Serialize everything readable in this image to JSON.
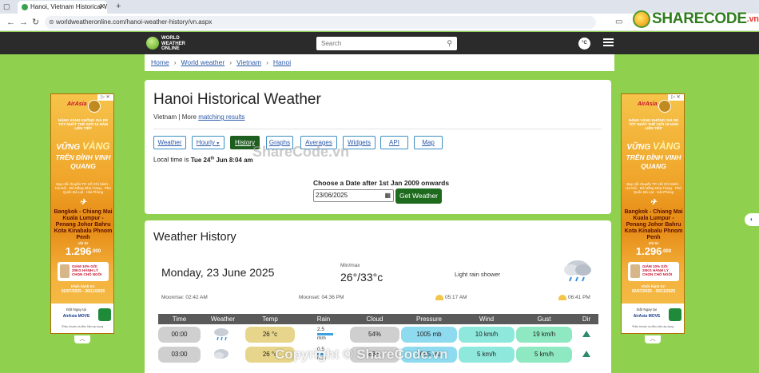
{
  "browser": {
    "tab_title": "Hanoi, Vietnam Historical Weat",
    "tab_close": "✕",
    "new_tab": "+",
    "url": "worldweatheronline.com/hanoi-weather-history/vn.aspx"
  },
  "watermark": {
    "logo_text": "SHARECODE",
    "logo_suffix": ".vn",
    "center_text": "ShareCode.vn",
    "bottom_text": "Copyright © ShareCode.vn"
  },
  "header": {
    "logo_lines": [
      "WORLD",
      "WEATHER",
      "ONLINE"
    ],
    "search_placeholder": "Search",
    "unit_toggle": "°C"
  },
  "breadcrumb": [
    "Home",
    "World weather",
    "Vietnam",
    "Hanoi"
  ],
  "page": {
    "title": "Hanoi Historical Weather",
    "country": "Vietnam",
    "more_label": " | More ",
    "matching_link": "matching results",
    "tabs": [
      {
        "label": "Weather",
        "active": false
      },
      {
        "label": "Hourly",
        "active": false
      },
      {
        "label": "History",
        "active": true
      },
      {
        "label": "Graphs",
        "active": false
      },
      {
        "label": "Averages",
        "active": false
      },
      {
        "label": "Widgets",
        "active": false
      },
      {
        "label": "API",
        "active": false
      },
      {
        "label": "Map",
        "active": false
      }
    ],
    "local_time_label": "Local time is ",
    "local_time_day": "Tue 24",
    "local_time_suffix": "th",
    "local_time_rest": " Jun 8:04 am",
    "date_label": "Choose a Date after 1st Jan 2009 onwards",
    "date_value": "23/06/2025",
    "get_weather": "Get Weather"
  },
  "history": {
    "heading": "Weather History",
    "day_title": "Monday, 23 June 2025",
    "minmax_label": "Min/max",
    "minmax_value": "26°/33°c",
    "condition": "Light rain shower",
    "moonrise": "Moonrise: 02:42 AM",
    "moonset": "Moonset: 04:36 PM",
    "sunrise": "05:17 AM",
    "sunset": "06:41 PM"
  },
  "table": {
    "headers": [
      "Time",
      "Weather",
      "Temp",
      "Rain",
      "Cloud",
      "Pressure",
      "Wind",
      "Gust",
      "Dir"
    ],
    "rows": [
      {
        "time": "00:00",
        "weather_icon": "rain-cloud-icon",
        "temp": "26 °c",
        "rain": "2.5",
        "rain_unit": "mm",
        "cloud": "54%",
        "pressure": "1005 mb",
        "wind": "10 km/h",
        "gust": "19 km/h"
      },
      {
        "time": "03:00",
        "weather_icon": "cloud-icon",
        "temp": "26 °c",
        "rain": "0.5",
        "rain_unit": "mm",
        "cloud": "63%",
        "pressure": "1005 mb",
        "wind": "5 km/h",
        "gust": "5 km/h"
      }
    ]
  },
  "ad": {
    "close_label": "▷ ✕",
    "brand": "AirAsia",
    "tagline": "NĂNG VÀNG KHÔNG GIÁ RẺ TỐT NHẤT THẾ GIỚI 16 NĂM LIÊN TIẾP",
    "headline_1": "VỮNG",
    "headline_gold": "VÀNG",
    "headline_2": "TRÊN ĐỈNH VINH QUANG",
    "route_intro": "Bay nối chuyến TP. Hồ Chí Minh · Hà Nội · Đà Nẵng Nha Trang · Phú Quốc Đà Lạt · Hải Phòng",
    "plane": "✈",
    "routes": "Bangkok - Chiang Mai Kuala Lumpur - Penang Johor Bahru Kota Kinabalu Phnom Penh",
    "price_from": "chỉ từ",
    "price": "1.296",
    "price_suffix": ".000",
    "card_text": "GIẢM 10% GÓI 20KG HÀNH LÝ CHỌN CHỖ NGỒI",
    "period_label": "Khởi hành từ:",
    "period": "02/07/2025 - 30/11/2025",
    "cta_label": "Đặt Ngay tại",
    "cta_app": "AirAsia MOVE",
    "disclaimer": "*Điều khoản và điều kiện áp dụng",
    "collapse": "︿"
  },
  "side_toggle": "◐"
}
